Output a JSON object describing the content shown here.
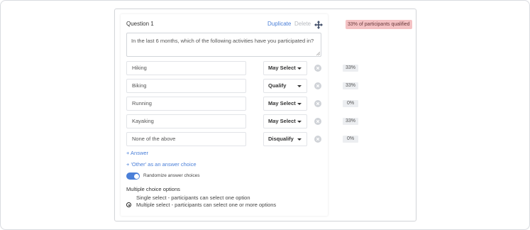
{
  "question": {
    "title": "Question 1",
    "duplicate_label": "Duplicate",
    "delete_label": "Delete",
    "qualified_text": "33% of participants qualified",
    "text": "In the last 6 months, which of the following activities have you participated in?"
  },
  "answers": [
    {
      "label": "Hiking",
      "rule": "May Select",
      "percent": "33%"
    },
    {
      "label": "Biking",
      "rule": "Qualify",
      "percent": "33%"
    },
    {
      "label": "Running",
      "rule": "May Select",
      "percent": "0%"
    },
    {
      "label": "Kayaking",
      "rule": "May Select",
      "percent": "33%"
    },
    {
      "label": "None of the above",
      "rule": "Disqualify",
      "percent": "0%"
    }
  ],
  "links": {
    "add_answer": "+ Answer",
    "add_other": "+ 'Other' as an answer choice"
  },
  "randomize": {
    "label": "Randomize answer choices",
    "enabled": true
  },
  "multiple_choice": {
    "heading": "Multiple choice options",
    "options": [
      {
        "label": "Single select - participants can select one option",
        "selected": false
      },
      {
        "label": "Multiple select - participants can select one or more options",
        "selected": true
      }
    ]
  },
  "colors": {
    "accent": "#4a7fd8",
    "badge_bg": "#f4c2c4"
  },
  "icons": {
    "move": "move-icon",
    "remove": "remove-circle-icon",
    "caret": "caret-down-icon"
  }
}
